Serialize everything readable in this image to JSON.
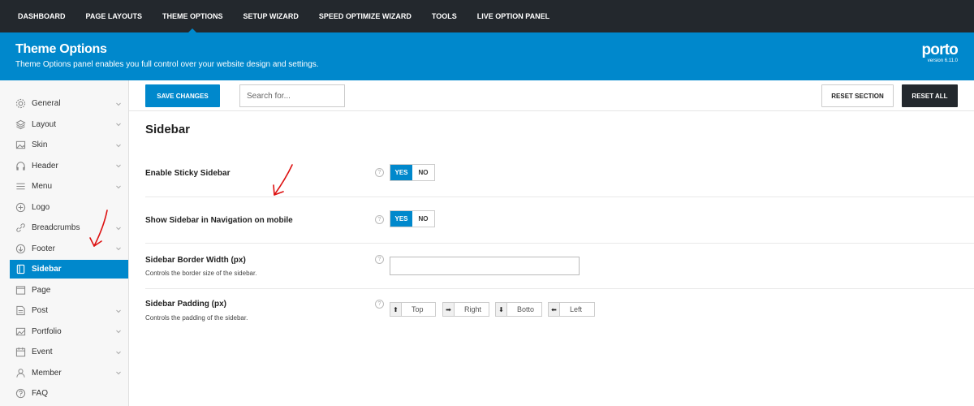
{
  "topnav": {
    "items": [
      "DASHBOARD",
      "PAGE LAYOUTS",
      "THEME OPTIONS",
      "SETUP WIZARD",
      "SPEED OPTIMIZE WIZARD",
      "TOOLS",
      "LIVE OPTION PANEL"
    ],
    "active": "THEME OPTIONS"
  },
  "banner": {
    "title": "Theme Options",
    "subtitle": "Theme Options panel enables you full control over your website design and settings.",
    "logo": "porto",
    "version": "version 6.11.0"
  },
  "sidebar": {
    "items": [
      {
        "label": "General",
        "icon": "gear-icon",
        "chevron": true
      },
      {
        "label": "Layout",
        "icon": "layers-icon",
        "chevron": true
      },
      {
        "label": "Skin",
        "icon": "image-icon",
        "chevron": true
      },
      {
        "label": "Header",
        "icon": "headphones-icon",
        "chevron": true
      },
      {
        "label": "Menu",
        "icon": "menu-icon",
        "chevron": true
      },
      {
        "label": "Logo",
        "icon": "plus-circle-icon",
        "chevron": false
      },
      {
        "label": "Breadcrumbs",
        "icon": "link-icon",
        "chevron": true
      },
      {
        "label": "Footer",
        "icon": "arrow-down-circle-icon",
        "chevron": true
      },
      {
        "label": "Sidebar",
        "icon": "sidebar-icon",
        "chevron": false,
        "active": true
      },
      {
        "label": "Page",
        "icon": "page-icon",
        "chevron": false
      },
      {
        "label": "Post",
        "icon": "post-icon",
        "chevron": true
      },
      {
        "label": "Portfolio",
        "icon": "portfolio-icon",
        "chevron": true
      },
      {
        "label": "Event",
        "icon": "calendar-icon",
        "chevron": true
      },
      {
        "label": "Member",
        "icon": "user-icon",
        "chevron": true
      },
      {
        "label": "FAQ",
        "icon": "question-icon",
        "chevron": false
      }
    ]
  },
  "toolbar": {
    "save_label": "SAVE CHANGES",
    "search_placeholder": "Search for...",
    "reset_section_label": "RESET SECTION",
    "reset_all_label": "RESET ALL"
  },
  "main": {
    "section_title": "Sidebar",
    "fields": {
      "sticky": {
        "label": "Enable Sticky Sidebar",
        "yes": "YES",
        "no": "NO",
        "value": "YES"
      },
      "nav_mobile": {
        "label": "Show Sidebar in Navigation on mobile",
        "yes": "YES",
        "no": "NO",
        "value": "YES"
      },
      "border_width": {
        "label": "Sidebar Border Width (px)",
        "desc": "Controls the border size of the sidebar.",
        "value": ""
      },
      "padding": {
        "label": "Sidebar Padding (px)",
        "desc": "Controls the padding of the sidebar.",
        "top": "Top",
        "right": "Right",
        "bottom": "Botto",
        "left": "Left"
      }
    },
    "help_glyph": "?"
  },
  "colors": {
    "accent": "#0088cc",
    "topnav_bg": "#23282d",
    "annotation": "#dd1111"
  }
}
